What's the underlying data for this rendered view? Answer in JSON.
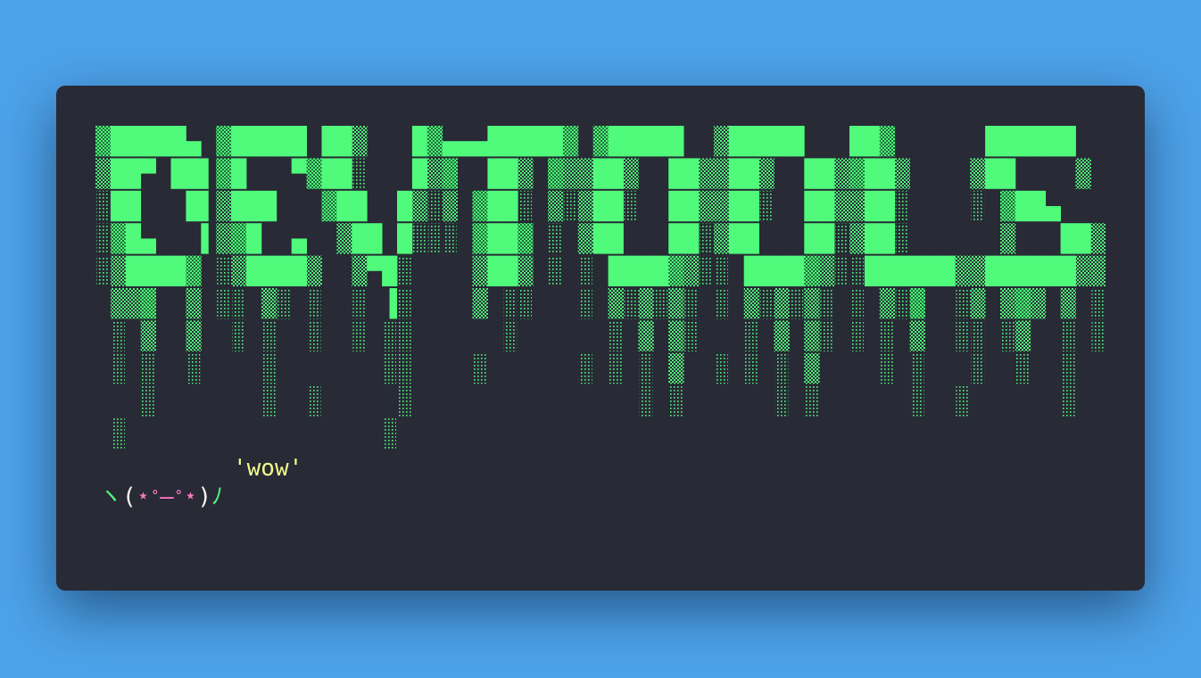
{
  "terminal": {
    "banner_text": "DEVTOOLS",
    "speech_bubble": "'wow'",
    "kaomoji": {
      "left_arm": "ヽ",
      "open_paren": "(",
      "left_star": "⋆",
      "left_eye": "˚",
      "mouth": "–",
      "right_eye": "˚",
      "right_star": "⋆",
      "close_paren": ")",
      "right_arm": "ﾉ"
    }
  },
  "colors": {
    "background": "#4da2e9",
    "terminal_bg": "#282a36",
    "banner_green": "#50fa7b",
    "speech_yellow": "#f1fa8c",
    "kaomoji_pink": "#ff79c6"
  },
  "banner_rows": [
    "▓█████▄ ▓█████ ██▒   █▓▄▄▄█████▓ ▓█████  ▒█████   ██▓      ██████ ",
    "▒██▀ ██▌▓█   ▀▓██░   █▒▓  ██▒ ▓▒▒██▒  ██▒▒██▒  ██▒▓██▒    ▒██    ▒ ",
    "░██   █▌▒███   ▓██  █▒░▒ ▓██░ ▒░▒██░  ██▒▒██░  ██▒▒██░    ░ ▓██▄   ",
    "░▓█▄   ▌▒▓█  ▄  ▒██ █░░░ ▓██▓ ░ ▒██   ██░▒██   ██░▒██░      ▒   ██▒",
    "░▒████▓ ░▒████▒  ▒▀█░    ▒██▒ ░ ░ ████▓▒░░ ████▓▒░░██████▒▒██████▒▒",
    " ▒▒▓  ▒ ░░ ▒░ ░  ░ ▐░    ▒ ░░   ░ ▒░▒░▒░ ░ ▒░▒░▒░ ░ ▒░▓  ░▒ ▒▓▒ ▒ ░",
    " ░ ▒  ▒  ░ ░  ░  ░ ░░      ░      ░ ▒ ▒░   ░ ▒ ▒░ ░ ░ ▒  ░░ ░▒  ░ ░",
    " ░ ░  ░    ░       ░░    ░      ░ ░ ░ ▒  ░ ░ ░ ▒    ░ ░   ░  ░  ░  ",
    "   ░       ░  ░     ░               ░ ░      ░ ░      ░  ░      ░  ",
    " ░                 ░                                               "
  ]
}
